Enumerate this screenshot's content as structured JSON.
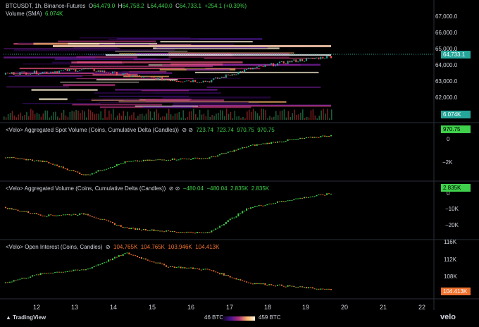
{
  "header": {
    "symbol": "BTCUSDT, 1h, Binance-Futures",
    "o_label": "O",
    "o_value": "64,479.0",
    "h_label": "H",
    "h_value": "64,758.2",
    "l_label": "L",
    "l_value": "64,440.0",
    "c_label": "C",
    "c_value": "64,733.1",
    "change": "+254.1 (+0.39%)",
    "volume_label": "Volume (SMA)",
    "volume_value": "6.074K"
  },
  "price_axis": [
    "67,000.0",
    "66,000.0",
    "65,000.0",
    "64,000.0",
    "63,000.0",
    "62,000.0"
  ],
  "price_tag": "64,733.1",
  "volume_tag": "6.074K",
  "panes": {
    "spot": {
      "title": "<Velo> Aggregated Spot Volume (Coins, Cumulative Delta (Candles))",
      "values": [
        "723.74",
        "723.74",
        "970.75",
        "970.75"
      ],
      "axis": [
        "0",
        "−2K"
      ],
      "tag": "970.75"
    },
    "agg": {
      "title": "<Velo> Aggregated Volume (Coins, Cumulative Delta (Candles))",
      "values": [
        "−480.04",
        "−480.04",
        "2.835K",
        "2.835K"
      ],
      "axis": [
        "0",
        "−10K",
        "−20K"
      ],
      "tag": "2.835K"
    },
    "oi": {
      "title": "<Velo> Open Interest (Coins, Candles)",
      "values": [
        "104.765K",
        "104.765K",
        "103.946K",
        "104.413K"
      ],
      "axis": [
        "116K",
        "112K",
        "108K"
      ],
      "tag": "104.413K"
    }
  },
  "x_axis": [
    "12",
    "13",
    "14",
    "15",
    "16",
    "17",
    "18",
    "19",
    "20",
    "21",
    "22"
  ],
  "footer": {
    "brand": "TradingView",
    "heat_min": "46 BTC",
    "heat_max": "459 BTC",
    "velo": "velo"
  },
  "colors": {
    "up": "#26a69a",
    "down": "#ef5350",
    "lime": "#3fd14b",
    "oi": "#f0722f"
  },
  "chart_data": [
    {
      "type": "candlestick",
      "title": "BTCUSDT, 1h, Binance-Futures",
      "x": [
        "12",
        "13",
        "14",
        "15",
        "16",
        "17",
        "18",
        "19",
        "20"
      ],
      "close": [
        63600,
        63700,
        63900,
        63500,
        63200,
        63100,
        63900,
        64400,
        64733
      ],
      "ylim": [
        61500,
        67500
      ]
    },
    {
      "type": "line",
      "title": "<Velo> Aggregated Spot Volume (Coins, Cumulative Delta (Candles))",
      "x": [
        "12",
        "13",
        "14",
        "15",
        "16",
        "17",
        "18",
        "19",
        "20"
      ],
      "values": [
        -800,
        -1200,
        -2300,
        -1200,
        -1000,
        -900,
        100,
        600,
        970.75
      ]
    },
    {
      "type": "line",
      "title": "<Velo> Aggregated Volume (Coins, Cumulative Delta (Candles))",
      "x": [
        "12",
        "13",
        "14",
        "15",
        "16",
        "17",
        "18",
        "19",
        "20"
      ],
      "values": [
        -6000,
        -11000,
        -10000,
        -19000,
        -21000,
        -22000,
        -6000,
        -1000,
        2835
      ]
    },
    {
      "type": "line",
      "title": "<Velo> Open Interest (Coins, Candles)",
      "x": [
        "12",
        "13",
        "14",
        "15",
        "16",
        "17",
        "18",
        "19",
        "20"
      ],
      "values": [
        106500,
        109500,
        110500,
        115500,
        111500,
        110500,
        106500,
        105500,
        104413
      ]
    }
  ]
}
